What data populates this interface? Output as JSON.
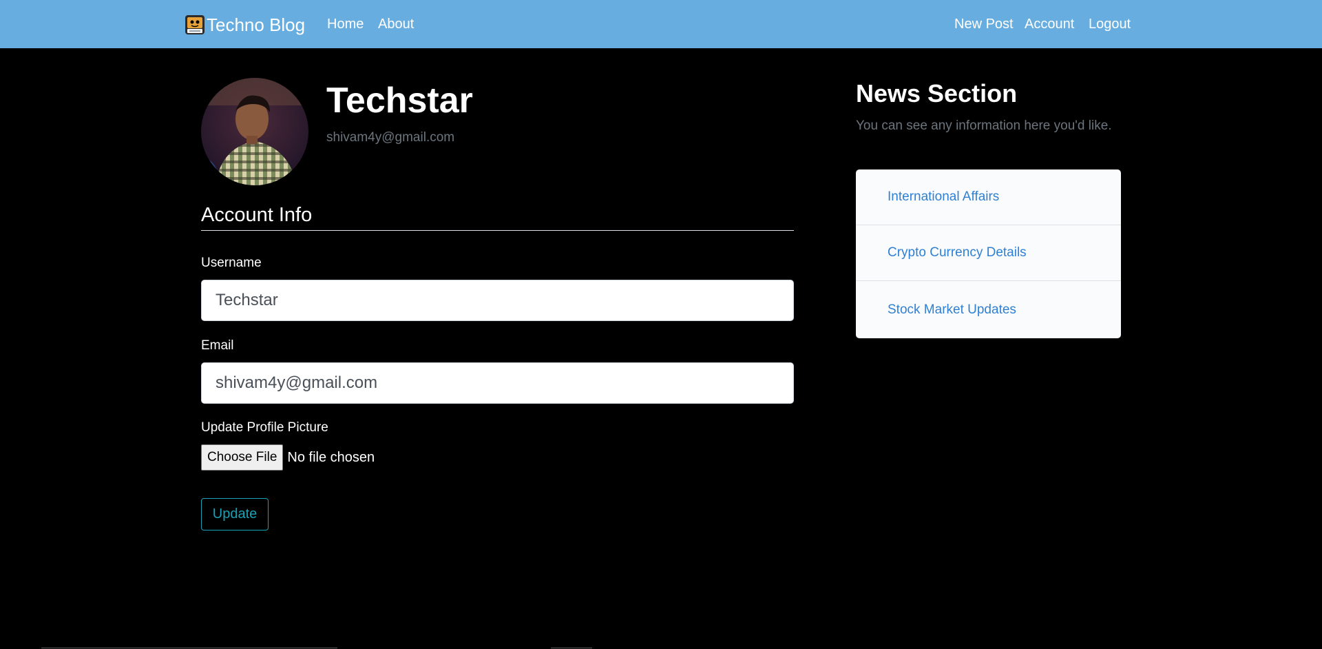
{
  "navbar": {
    "brand": "Techno Blog",
    "left_links": [
      "Home",
      "About"
    ],
    "right_links": [
      "New Post",
      "Account",
      "Logout"
    ],
    "bg_color": "#68ade0"
  },
  "profile": {
    "name": "Techstar",
    "email": "shivam4y@gmail.com"
  },
  "form": {
    "legend": "Account Info",
    "username_label": "Username",
    "username_value": "Techstar",
    "email_label": "Email",
    "email_value": "shivam4y@gmail.com",
    "picture_label": "Update Profile Picture",
    "file_button": "Choose File",
    "file_status": "No file chosen",
    "submit_label": "Update"
  },
  "news": {
    "title": "News Section",
    "subtitle": "You can see any information here you'd like.",
    "items": [
      "International Affairs",
      "Crypto Currency Details",
      "Stock Market Updates"
    ]
  }
}
